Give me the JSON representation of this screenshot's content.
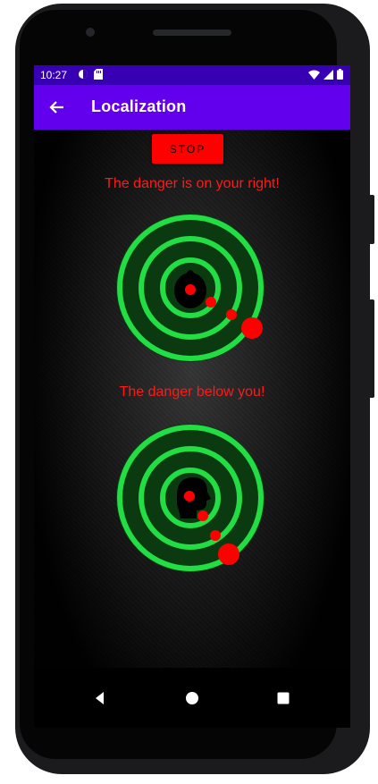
{
  "status_bar": {
    "time": "10:27"
  },
  "app_bar": {
    "title": "Localization"
  },
  "controls": {
    "stop_label": "STOP"
  },
  "messages": {
    "top": "The danger is on your right!",
    "bottom": "The danger below you!"
  },
  "colors": {
    "status_bar": "#3700b3",
    "app_bar": "#6200ee",
    "ring_green": "#22dd44",
    "danger_red": "#ff0000",
    "message_red": "#ff1a1a"
  }
}
